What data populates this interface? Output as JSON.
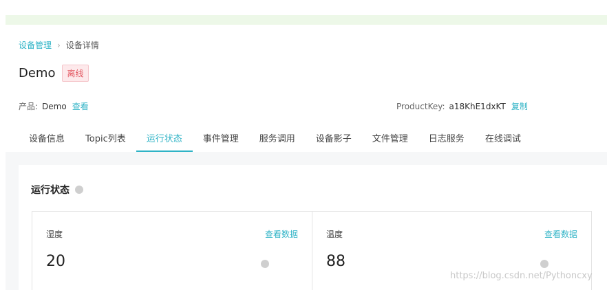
{
  "breadcrumb": {
    "parent": "设备管理",
    "separator": "›",
    "current": "设备详情"
  },
  "device": {
    "name": "Demo",
    "status": "离线"
  },
  "product": {
    "label": "产品:",
    "value": "Demo",
    "action": "查看"
  },
  "product_key": {
    "label": "ProductKey:",
    "value": "a18KhE1dxKT",
    "action": "复制"
  },
  "tabs": [
    {
      "label": "设备信息"
    },
    {
      "label": "Topic列表"
    },
    {
      "label": "运行状态"
    },
    {
      "label": "事件管理"
    },
    {
      "label": "服务调用"
    },
    {
      "label": "设备影子"
    },
    {
      "label": "文件管理"
    },
    {
      "label": "日志服务"
    },
    {
      "label": "在线调试"
    }
  ],
  "active_tab": "运行状态",
  "section": {
    "title": "运行状态"
  },
  "cards": [
    {
      "label": "湿度",
      "action": "查看数据",
      "value": "20"
    },
    {
      "label": "温度",
      "action": "查看数据",
      "value": "88"
    }
  ],
  "watermark": "https://blog.csdn.net/Pythoncxy",
  "colors": {
    "accent": "#2fb3c6",
    "offline": "#e2555f"
  }
}
